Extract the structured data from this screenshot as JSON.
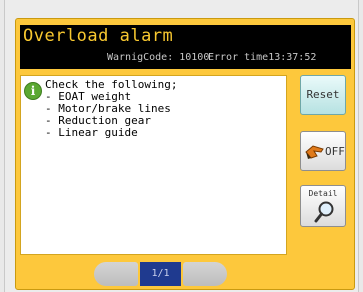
{
  "header": {
    "title": "Overload alarm",
    "warning_code": "WarnigCode: 10100",
    "error_time": "Error time13:37:52"
  },
  "message": {
    "icon": "info-icon",
    "lines": [
      "Check the following;",
      "- EOAT weight",
      "- Motor/brake lines",
      "- Reduction gear",
      "- Linear guide"
    ]
  },
  "buttons": {
    "reset": "Reset",
    "off": "OFF",
    "off_icon": "hand-pointer-icon",
    "detail": "Detail",
    "detail_icon": "magnifier-icon"
  },
  "pager": {
    "page": "1/1"
  },
  "colors": {
    "panel": "#fdc83c",
    "title_text": "#f8c830",
    "pager_active": "#1f3a8f"
  }
}
